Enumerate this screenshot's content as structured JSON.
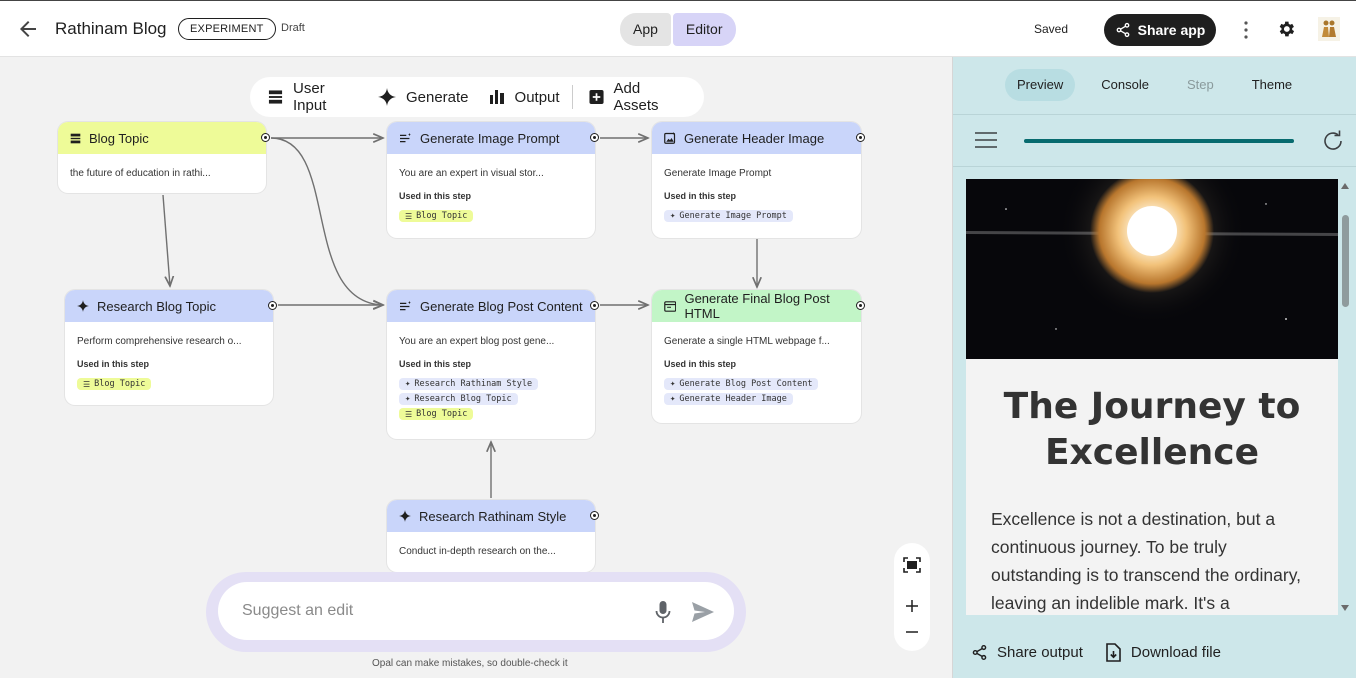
{
  "header": {
    "title": "Rathinam Blog",
    "badge": "EXPERIMENT",
    "status": "Draft",
    "mode_tabs": [
      "App",
      "Editor"
    ],
    "saved": "Saved",
    "share_label": "Share app"
  },
  "toolbar": {
    "user_input": "User Input",
    "generate": "Generate",
    "output": "Output",
    "add_assets": "Add Assets"
  },
  "nodes": {
    "blog_topic": {
      "title": "Blog Topic",
      "desc": "the future of education in rathi..."
    },
    "gen_image_prompt": {
      "title": "Generate Image Prompt",
      "desc": "You are an expert in visual stor...",
      "used": "Used in this step",
      "chips": [
        "Blog Topic"
      ]
    },
    "gen_header_image": {
      "title": "Generate Header Image",
      "desc": "Generate Image Prompt",
      "used": "Used in this step",
      "chips": [
        "Generate Image Prompt"
      ]
    },
    "research_blog_topic": {
      "title": "Research Blog Topic",
      "desc": "Perform comprehensive research o...",
      "used": "Used in this step",
      "chips": [
        "Blog Topic"
      ]
    },
    "gen_blog_post": {
      "title": "Generate Blog Post Content",
      "desc": "You are an expert blog post gene...",
      "used": "Used in this step",
      "chips": [
        "Research Rathinam Style",
        "Research Blog Topic",
        "Blog Topic"
      ]
    },
    "gen_final_html": {
      "title": "Generate Final Blog Post HTML",
      "desc": "Generate a single HTML webpage f...",
      "used": "Used in this step",
      "chips": [
        "Generate Blog Post Content",
        "Generate Header Image"
      ]
    },
    "research_style": {
      "title": "Research Rathinam Style",
      "desc": "Conduct in-depth research on the..."
    }
  },
  "suggest": {
    "placeholder": "Suggest an edit",
    "disclaimer": "Opal can make mistakes, so double-check it"
  },
  "panel": {
    "tabs": [
      "Preview",
      "Console",
      "Step",
      "Theme"
    ],
    "progress": 1.0,
    "post_title": "The Journey to Excellence",
    "post_text": "Excellence is not a destination, but a continuous journey. To be truly outstanding is to transcend the ordinary, leaving an indelible mark. It's a",
    "share_output": "Share output",
    "download": "Download file"
  },
  "colors": {
    "input_node": "#eefb98",
    "generate_node": "#c9d5fa",
    "output_node": "#c2f5c7",
    "panel_bg": "#cde7ea",
    "accent": "#076b6f"
  }
}
